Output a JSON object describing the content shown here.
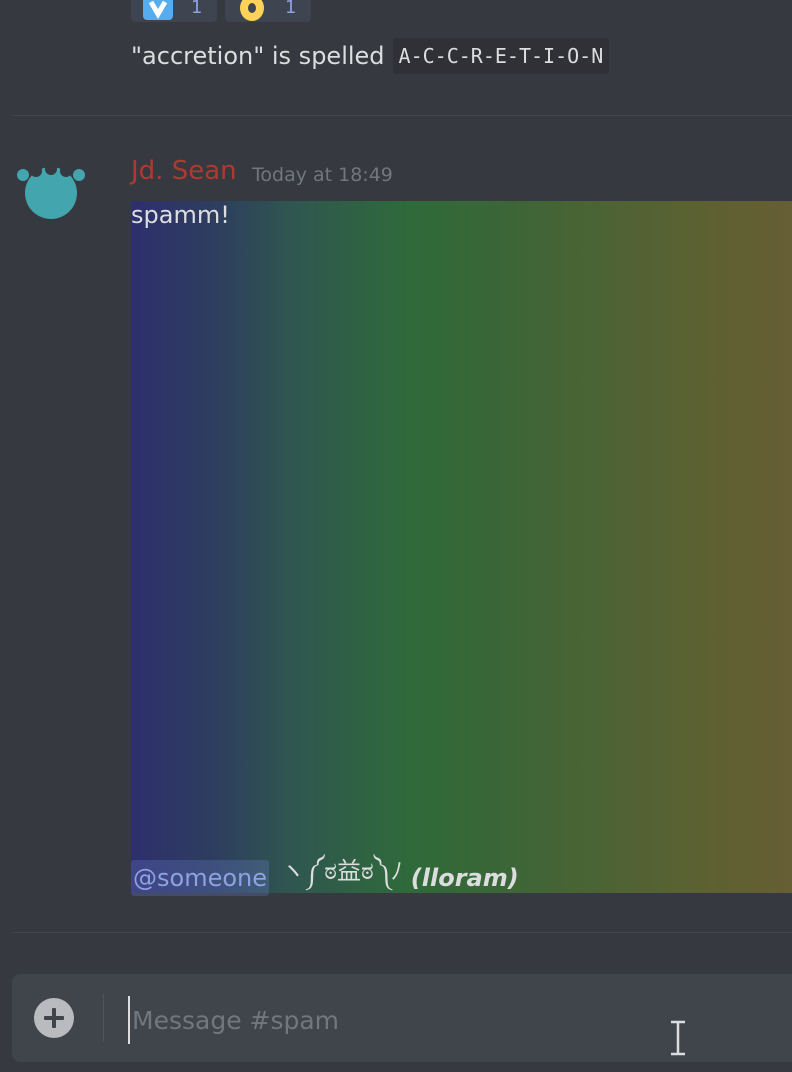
{
  "reactions": [
    {
      "icon": "shield-check-icon",
      "count": "1"
    },
    {
      "icon": "coin-icon",
      "count": "1"
    }
  ],
  "previous_message": {
    "text_prefix": "\"accretion\" is spelled",
    "code": "A-C-C-R-E-T-I-O-N"
  },
  "message": {
    "username": "Jd. Sean",
    "timestamp": "Today at 18:49",
    "text": "spamm!",
    "mention": "@someone",
    "kaomoji": "ヽ༼ಠ益ಠ༽ﾉ",
    "credit": "(lloram)"
  },
  "colors": {
    "username": "#ad3a30",
    "avatar": "#43a5ad",
    "mention": "#8ea1e1",
    "background": "#36393f"
  },
  "composer": {
    "placeholder": "Message #spam"
  }
}
